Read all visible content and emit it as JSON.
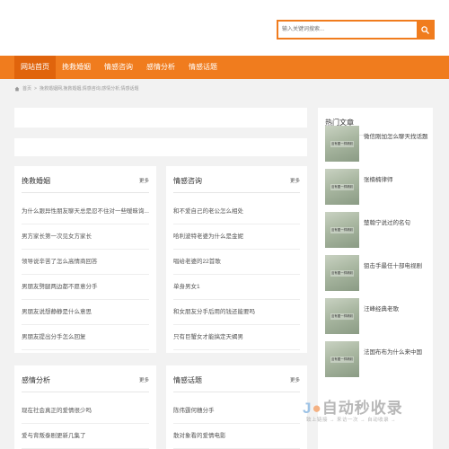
{
  "search": {
    "placeholder": "输入关键词搜索..."
  },
  "nav": [
    {
      "label": "网站首页"
    },
    {
      "label": "挽救婚姻"
    },
    {
      "label": "情感咨询"
    },
    {
      "label": "感情分析"
    },
    {
      "label": "情感话题"
    }
  ],
  "breadcrumb": {
    "home": "首页",
    "sep": ">",
    "path": "挽救婚姻网,挽救婚姻,情感咨询,感情分析,情感话题"
  },
  "panels": [
    {
      "title": "挽救婚姻",
      "more": "更多",
      "items": [
        "为什么跟异性朋友聊天总是忍不住对一些暧昧询...",
        "男方家长第一次见女方家长",
        "领导说辛苦了怎么高情商回答",
        "男朋友劈腿两边都不愿意分手",
        "男朋友说想静静是什么意思",
        "男朋友提出分手怎么回复"
      ]
    },
    {
      "title": "情感咨询",
      "more": "更多",
      "items": [
        "和不爱自己的老公怎么相处",
        "哈利波特老婆为什么是金妮",
        "唱给老婆的22首歌",
        "单身男女1",
        "和女朋友分手后用的钱还能要吗",
        "只有巨蟹女才能搞定天蝎男"
      ]
    },
    {
      "title": "感情分析",
      "more": "更多",
      "items": [
        "现在社会真正的爱情很少吗",
        "爱与背叛泰剧更新几集了"
      ]
    },
    {
      "title": "情感话题",
      "more": "更多",
      "items": [
        "陈伟霆何穗分手",
        "散对象看的爱情电影"
      ]
    }
  ],
  "sidebar": {
    "title": "热门文章",
    "thumb_text": "没有图一样精彩",
    "items": [
      {
        "title": "微信刚加怎么聊天找话题"
      },
      {
        "title": "张楠楠律师"
      },
      {
        "title": "楚翰宁说过的名句"
      },
      {
        "title": "狙击手最任十部电视剧"
      },
      {
        "title": "汪峰经典老歌"
      },
      {
        "title": "法国布布为什么来中国"
      }
    ]
  },
  "watermark": {
    "logo_a": "J",
    "logo_b": "自动秒收录",
    "tagline": "致上链接 → 来访一次 → 自动收录 →"
  },
  "colors": {
    "brand": "#f07c1e",
    "nav_active": "#e0640c",
    "page_bg": "#f2f2f2"
  },
  "icons": {
    "search": "search-icon",
    "home": "home-icon"
  }
}
